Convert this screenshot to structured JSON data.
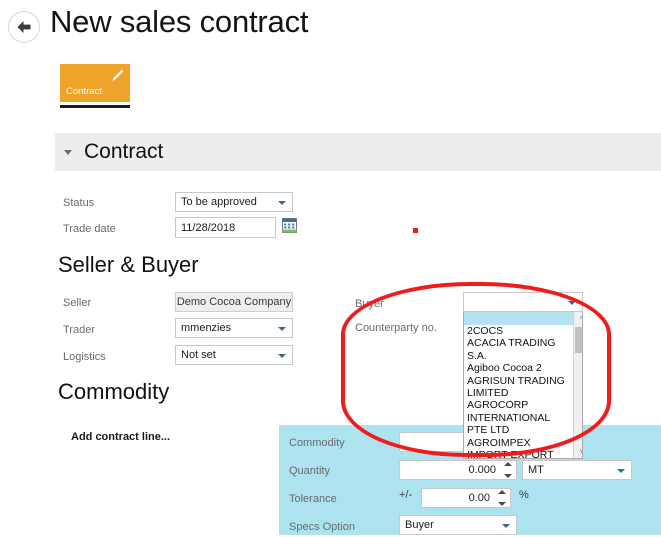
{
  "header": {
    "back_icon": "back-arrow-icon",
    "title": "New sales contract"
  },
  "tile": {
    "label": "Contract",
    "edit_icon": "pencil-icon",
    "color": "#f0a32a"
  },
  "contract_section": {
    "title": "Contract",
    "collapse_icon": "chevron-down-icon",
    "fields": [
      {
        "label": "Status",
        "value": "To be approved",
        "type": "select"
      },
      {
        "label": "Trade date",
        "value": "11/28/2018",
        "type": "date",
        "icon": "calendar-icon"
      }
    ]
  },
  "seller_buyer": {
    "heading": "Seller & Buyer",
    "left_fields": [
      {
        "label": "Seller",
        "value": "Demo Cocoa Company",
        "type": "readonly"
      },
      {
        "label": "Trader",
        "value": "mmenzies",
        "type": "select"
      },
      {
        "label": "Logistics",
        "value": "Not set",
        "type": "select"
      }
    ],
    "right_fields": [
      {
        "label": "Buyer",
        "value": "",
        "type": "select"
      },
      {
        "label": "Counterparty no.",
        "value": "",
        "type": "text"
      }
    ]
  },
  "buyer_dropdown": {
    "open": true,
    "selected": "",
    "options": [
      "",
      "2COCS",
      "ACACIA TRADING S.A.",
      "Agiboo Cocoa 2",
      "AGRISUN TRADING LIMITED",
      "AGROCORP INTERNATIONAL PTE LTD",
      "AGROIMPEX IMPORT-EXPORT GMBH"
    ],
    "scroll_up_icon": "chevron-up-icon",
    "scroll_down_icon": "chevron-down-icon"
  },
  "commodity": {
    "heading": "Commodity",
    "add_line_label": "Add contract line...",
    "panel_color": "#ade3ef",
    "fields": [
      {
        "label": "Commodity",
        "value": "",
        "type": "text"
      },
      {
        "label": "Quantity",
        "value": "0.000",
        "type": "number",
        "unit": "MT"
      },
      {
        "label": "Tolerance",
        "prefix": "+/-",
        "value": "0.00",
        "type": "number",
        "suffix": "%"
      },
      {
        "label": "Specs Option",
        "value": "Buyer",
        "type": "select"
      }
    ]
  },
  "annotations": {
    "ellipse_color": "#ee1c1c",
    "dot_color": "#ee1c1c"
  }
}
